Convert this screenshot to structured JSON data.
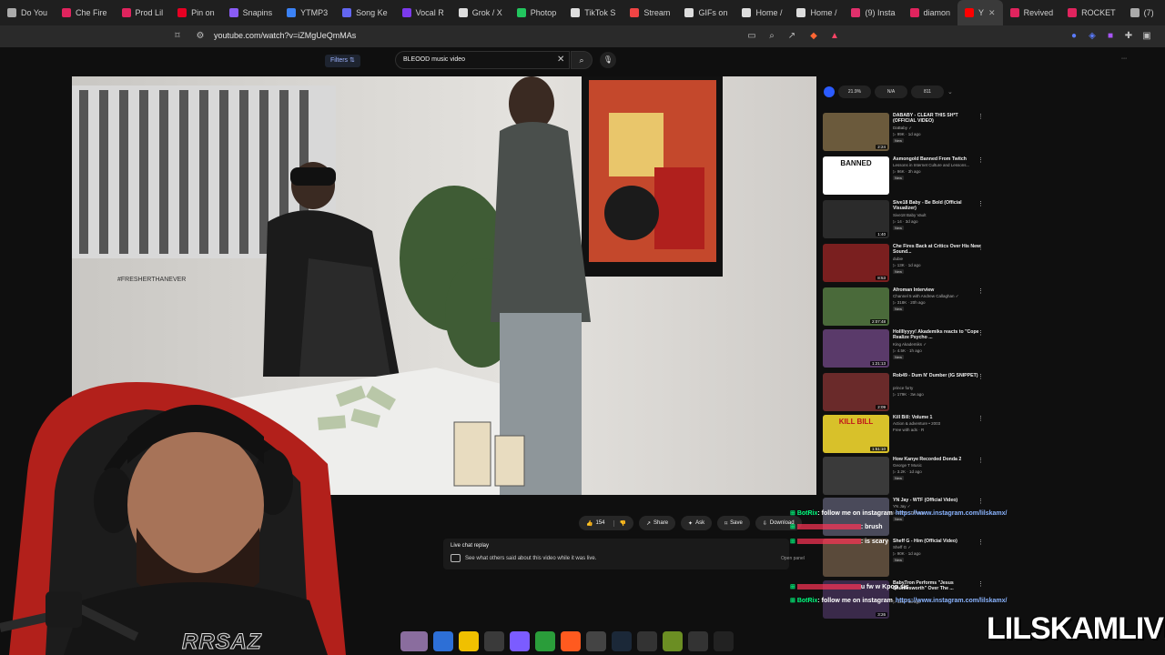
{
  "browser": {
    "tabs": [
      {
        "label": "Do You",
        "color": "#aaaaaa"
      },
      {
        "label": "Che Fire",
        "color": "#e0245e"
      },
      {
        "label": "Prod Lil",
        "color": "#e0245e"
      },
      {
        "label": "Pin on",
        "color": "#e60023"
      },
      {
        "label": "Snapins",
        "color": "#8a5cf6"
      },
      {
        "label": "YTMP3",
        "color": "#3b82f6"
      },
      {
        "label": "Song Ke",
        "color": "#6366f1"
      },
      {
        "label": "Vocal R",
        "color": "#7c3aed"
      },
      {
        "label": "Grok / X",
        "color": "#dddddd"
      },
      {
        "label": "Photop",
        "color": "#22c55e"
      },
      {
        "label": "TikTok S",
        "color": "#dddddd"
      },
      {
        "label": "Stream",
        "color": "#ef4444"
      },
      {
        "label": "GIFs on",
        "color": "#dddddd"
      },
      {
        "label": "Home /",
        "color": "#dddddd"
      },
      {
        "label": "Home /",
        "color": "#dddddd"
      },
      {
        "label": "(9) Insta",
        "color": "#e1306c"
      },
      {
        "label": "diamon",
        "color": "#e0245e"
      },
      {
        "label": "Y",
        "color": "#ff0000",
        "active": true
      },
      {
        "label": "Revived",
        "color": "#e0245e"
      },
      {
        "label": "ROCKET",
        "color": "#e0245e"
      },
      {
        "label": "(7)",
        "color": "#aaaaaa"
      }
    ],
    "tab_close": "✕",
    "url": "youtube.com/watch?v=iZMgUeQmMAs"
  },
  "youtube": {
    "filters_label": "Filters ⇅",
    "search_value": "BLEOOD music video",
    "search_clear": "✕",
    "search_icon": "search-icon",
    "mic_icon": "mic-icon"
  },
  "video_scene": {
    "poster_text": "#FRESHERTHANEVER"
  },
  "actions": {
    "like_count": "154",
    "share_label": "Share",
    "ask_label": "Ask",
    "save_label": "Save",
    "download_label": "Download"
  },
  "chat_replay": {
    "title": "Live chat replay",
    "subtitle": "See what others said about this video while it was live.",
    "open_panel": "Open panel"
  },
  "stats": [
    "21.9%",
    "N/A",
    "811"
  ],
  "recommended": [
    {
      "title": "DABABY - CLEAR THIS SH*T (OFFICIAL VIDEO)",
      "channel": "DaBaby ✓",
      "meta": "▷ 99K · 1d ago",
      "new": "New",
      "duration": "2:24",
      "thumb_color": "#6b5a3c"
    },
    {
      "title": "Asmongold Banned From Twitch",
      "channel": "Lessons in Internet Culture and Lessons...",
      "meta": "▷ 96K · 3h ago",
      "new": "New",
      "duration": "",
      "thumb_color": "#ffffff",
      "thumb_label": "BANNED"
    },
    {
      "title": "Sive18 Baby - Be Bold (Official Visualizer)",
      "channel": "Sive18 Baby Vault",
      "meta": "▷ 14 · 3d ago",
      "new": "New",
      "duration": "1:40",
      "thumb_color": "#2b2b2b"
    },
    {
      "title": "Che Fires Back at Critics Over His New Sound...",
      "channel": "dubie",
      "meta": "▷ 13K · 1d ago",
      "new": "New",
      "duration": "8:53",
      "thumb_color": "#7a1f1f"
    },
    {
      "title": "Afroman Interview",
      "channel": "Channel 5 with Andrew Callaghan ✓",
      "meta": "▷ 318K · 20h ago",
      "new": "New",
      "duration": "2:07:48",
      "thumb_color": "#4a6a3a"
    },
    {
      "title": "Hollllyyyy! Akademiks reacts to \"Cope Realize Psycho ...",
      "channel": "King Akademiks ✓",
      "meta": "▷ 4.5K · 1h ago",
      "new": "New",
      "duration": "1:21:13",
      "thumb_color": "#5a3a6a"
    },
    {
      "title": "Rob49 - Dum N' Dumber (IG SNIPPET)",
      "channel": "prince forty",
      "meta": "▷ 179K · 3w ago",
      "new": "",
      "duration": "2:09",
      "thumb_color": "#6a2a2a"
    },
    {
      "title": "Kill Bill: Volume 1",
      "channel": "Action & adventure • 2003",
      "meta": "Free with ads · R",
      "new": "",
      "duration": "1:51:10",
      "thumb_color": "#d8c12a",
      "thumb_label": "KILL BILL"
    },
    {
      "title": "How Kanye Recorded Donda 2",
      "channel": "George T Music",
      "meta": "▷ 3.2K · 1d ago",
      "new": "New",
      "duration": "",
      "thumb_color": "#3a3a3a"
    },
    {
      "title": "YN Jay - WTF (Official Video)",
      "channel": "YN Jay ✓",
      "meta": "▷ 237K · 10h ago",
      "new": "New",
      "duration": "",
      "thumb_color": "#4a4a5a"
    },
    {
      "title": "Sheff G - Him (Official Video)",
      "channel": "Sheff G ✓",
      "meta": "▷ 90K · 1d ago",
      "new": "New",
      "duration": "",
      "thumb_color": "#5a4a3a"
    },
    {
      "title": "BabyTron Performs \"Jesus Shuttlesworth\" Over The ...",
      "channel": "",
      "meta": "▷ 12K · 1d ago",
      "new": "",
      "duration": "3:26",
      "thumb_color": "#3a2a4a"
    }
  ],
  "chat_overlay": [
    {
      "user": "BotRix",
      "text": ": follow me on instagram",
      "link": "https://www.instagram.com/lilskamx/"
    },
    {
      "user": "",
      "text": ": brush",
      "link": ""
    },
    {
      "user": "",
      "text": ": is scary",
      "link": ""
    },
    {
      "user": "",
      "text": "u fw w Kpop sis",
      "link": ""
    },
    {
      "user": "BotRix",
      "text": ": follow me on instagram",
      "link": "https://www.instagram.com/lilskamx/"
    }
  ],
  "webcam": {
    "shirt_text": "RRSAZ"
  },
  "brand": "LILSKAMLIVE",
  "colors": {
    "youtube_red": "#ff0000",
    "chat_green": "#00ff7f",
    "chat_user_red": "#ff3355",
    "chat_link": "#8ab4ff"
  }
}
